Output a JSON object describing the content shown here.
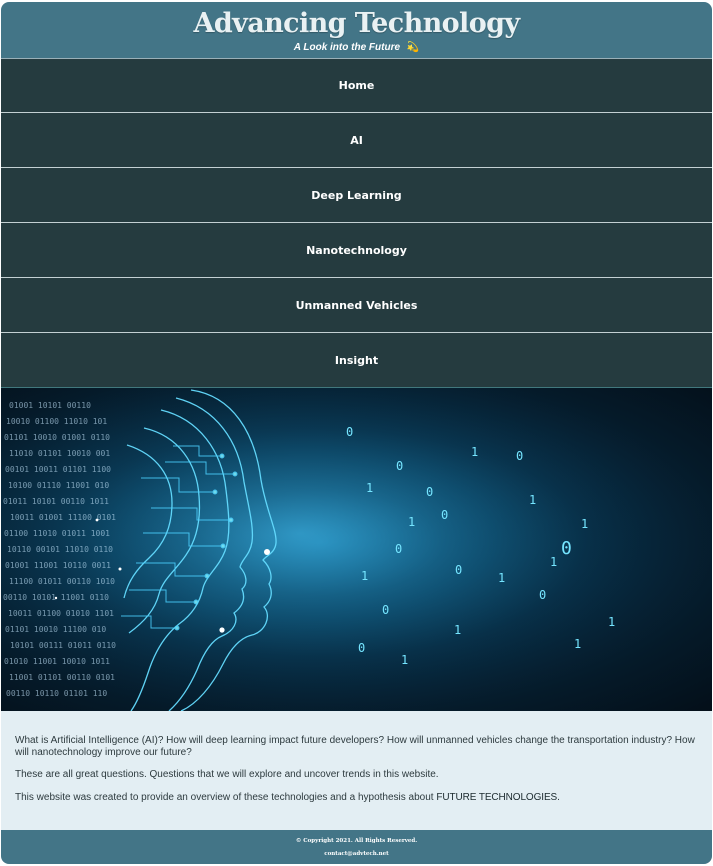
{
  "header": {
    "title": "Advancing Technology",
    "subtitle": "A Look into the Future",
    "subtitle_icon": "💫"
  },
  "nav": {
    "items": [
      {
        "label": "Home"
      },
      {
        "label": "AI"
      },
      {
        "label": "Deep Learning"
      },
      {
        "label": "Nanotechnology"
      },
      {
        "label": "Unmanned Vehicles"
      },
      {
        "label": "Insight"
      }
    ]
  },
  "hero": {
    "image": "ai-head-circuit-image",
    "colors": {
      "glow": "#1c7aa6",
      "dark": "#040f19",
      "accent": "#59d4ff"
    }
  },
  "intro": {
    "paragraph_1": "What is Artificial Intelligence (AI)? How will deep learning impact future developers? How will unmanned vehicles change the transportation industry? How will nanotechnology improve our future?",
    "paragraph_2": "These are all great questions. Questions that we will explore and uncover trends in this website.",
    "paragraph_3_prefix": "This website was created to provide an overview of these technologies and a hypothesis about ",
    "paragraph_3_emphasis": "FUTURE TECHNOLOGIES",
    "paragraph_3_suffix": "."
  },
  "footer": {
    "copyright": "© Copyright 2021. All Rights Reserved.",
    "email": "contact@advtech.net"
  },
  "colors": {
    "header_bg": "#437587",
    "nav_bg": "#253b3f",
    "content_bg": "#e3eef3",
    "footer_bg": "#437587"
  }
}
